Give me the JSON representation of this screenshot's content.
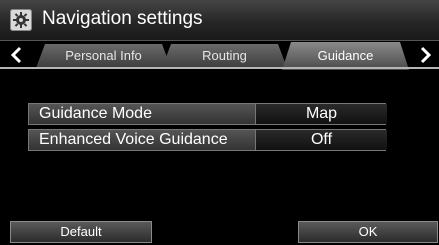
{
  "window": {
    "title": "Navigation settings"
  },
  "tabs": [
    {
      "label": "Personal Info",
      "active": false
    },
    {
      "label": "Routing",
      "active": false
    },
    {
      "label": "Guidance",
      "active": true
    }
  ],
  "settings": [
    {
      "label": "Guidance Mode",
      "value": "Map"
    },
    {
      "label": "Enhanced Voice Guidance",
      "value": "Off"
    }
  ],
  "buttons": {
    "default_label": "Default",
    "ok_label": "OK"
  },
  "icons": {
    "title": "gear-icon",
    "prev": "chevron-left-icon",
    "next": "chevron-right-icon"
  }
}
